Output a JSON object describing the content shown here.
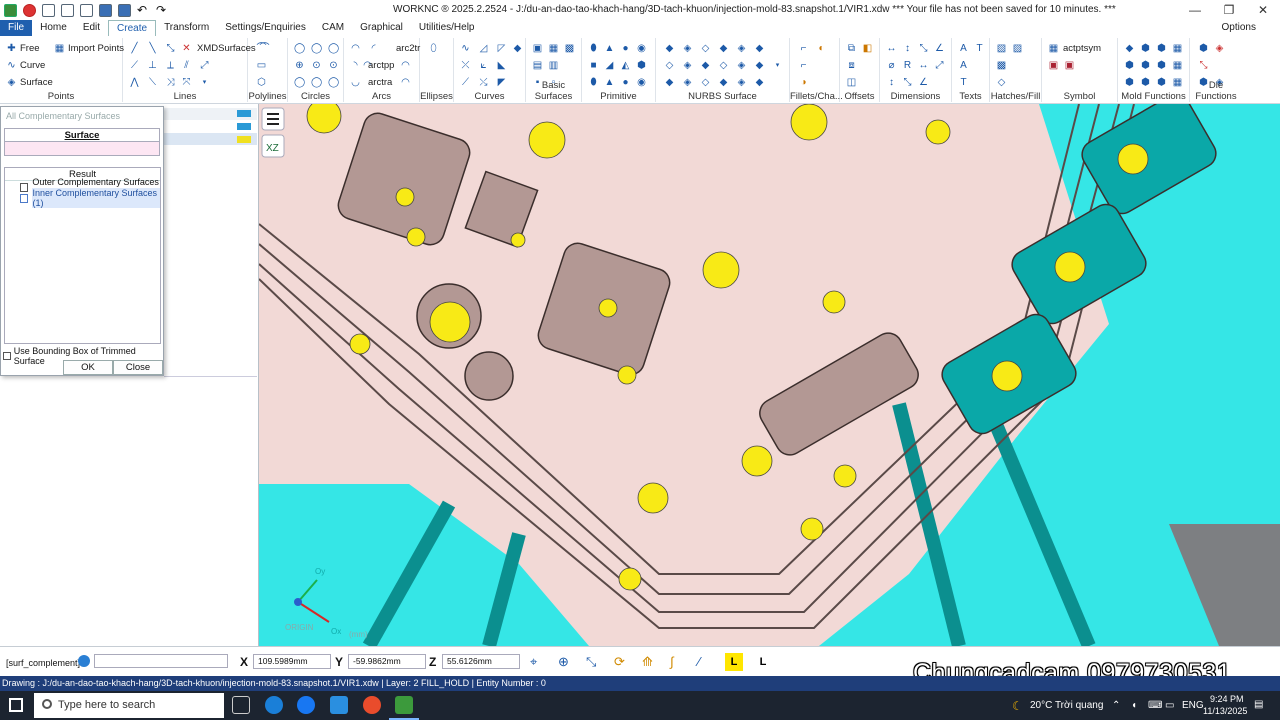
{
  "window": {
    "title": "WORKNC ® 2025.2.2524 - J:/du-an-dao-tao-khach-hang/3D-tach-khuon/injection-mold-83.snapshot.1/VIR1.xdw *** Your file has not been saved for 10 minutes. ***",
    "controls": [
      "—",
      "❐",
      "✕"
    ]
  },
  "menu": {
    "items": [
      "File",
      "Home",
      "Edit",
      "Create",
      "Transform",
      "Settings/Enquiries",
      "CAM",
      "Graphical",
      "Utilities/Help"
    ],
    "active": "Create",
    "options_label": "Options"
  },
  "ribbon": {
    "points": {
      "label": "Points",
      "free": "Free",
      "import_points": "Import Points",
      "curve": "Curve",
      "surface": "Surface"
    },
    "lines": {
      "label": "Lines",
      "xmd": "XMDSurfaces"
    },
    "polylines": {
      "label": "Polylines"
    },
    "circles": {
      "label": "Circles"
    },
    "arcs": {
      "label": "Arcs",
      "arc2tr": "arc2tr",
      "arctpp": "arctpp",
      "arctra": "arctra"
    },
    "ellipses": {
      "label": "Ellipses"
    },
    "curves": {
      "label": "Curves"
    },
    "basic": {
      "label": "Basic Surfaces"
    },
    "primitives": {
      "label": "Primitive"
    },
    "nurbs": {
      "label": "NURBS Surface"
    },
    "fillets": {
      "label": "Fillets/Cha..."
    },
    "offsets": {
      "label": "Offsets"
    },
    "dimensions": {
      "label": "Dimensions"
    },
    "texts": {
      "label": "Texts"
    },
    "hatches": {
      "label": "Hatches/Fill"
    },
    "symbol": {
      "label": "Symbol",
      "actptsym": "actptsym"
    },
    "mold": {
      "label": "Mold Functions"
    },
    "die": {
      "label": "Die Functions"
    }
  },
  "dialog": {
    "title": "All Complementary Surfaces",
    "surface_tab": "Surface",
    "result_header": "Result",
    "results": [
      {
        "label": "Outer Complementary Surfaces (2)",
        "selected": false
      },
      {
        "label": "Inner Complementary Surfaces (1)",
        "selected": true
      }
    ],
    "bounding_box_label": "Use Bounding Box of Trimmed Surface",
    "ok": "OK",
    "close": "Close"
  },
  "viewport": {
    "axis_labels": {
      "y": "Oy",
      "x": "Ox",
      "origin": "ORIGIN",
      "units": "(mm)"
    },
    "colors": {
      "part": "#f2d9d6",
      "mold": "#3fe8e8",
      "marker": "#f8ea16"
    }
  },
  "command": {
    "label": "[surf_complement]",
    "x_label": "X",
    "x": "109.5989mm",
    "y_label": "Y",
    "y": "-59.9862mm",
    "z_label": "Z",
    "z": "55.6126mm"
  },
  "status": "Drawing : J:/du-an-dao-tao-khach-hang/3D-tach-khuon/injection-mold-83.snapshot.1/VIR1.xdw | Layer: 2 FILL_HOLD | Entity Number : 0",
  "watermark": "Chungcadcam 0979730531",
  "taskbar": {
    "search_placeholder": "Type here to search",
    "weather": "20°C  Trời quang",
    "lang": "ENG",
    "time": "9:24 PM",
    "date": "11/13/2025"
  }
}
